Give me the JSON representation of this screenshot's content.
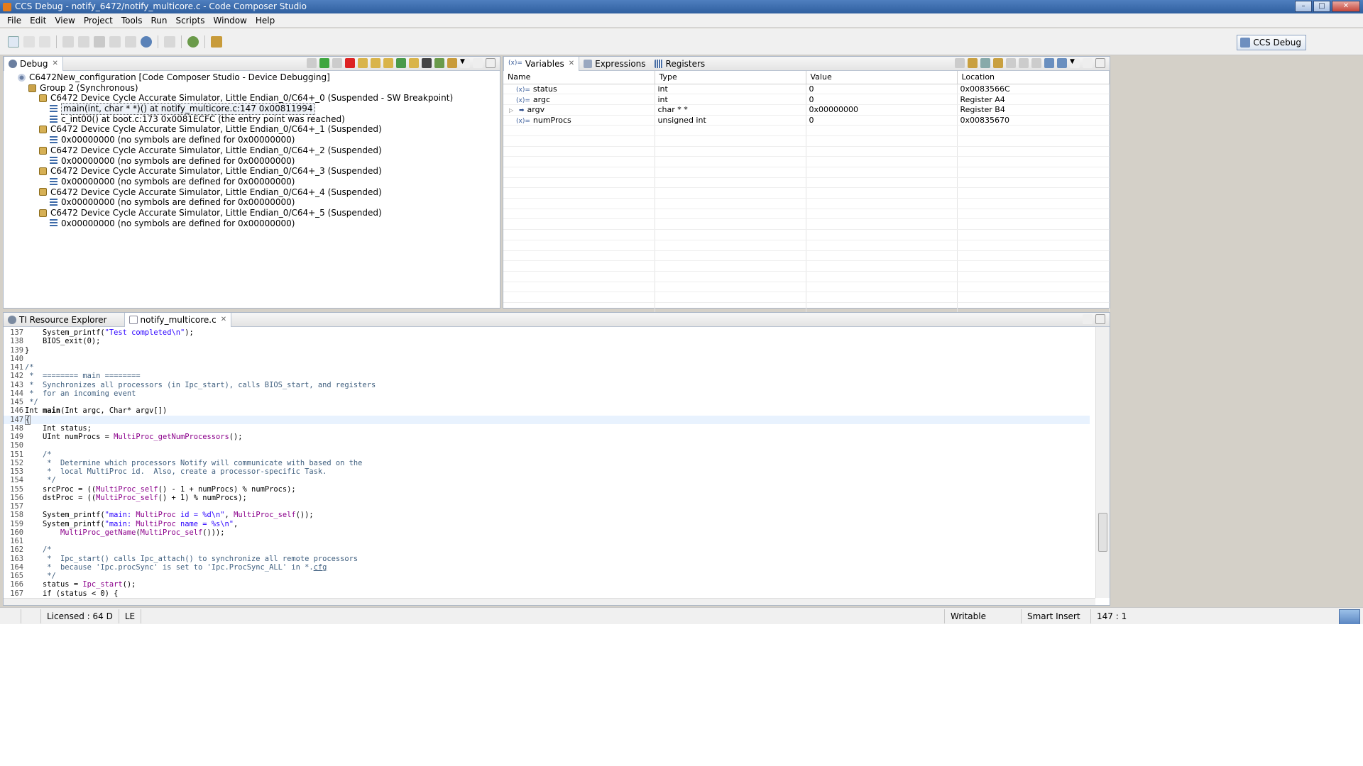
{
  "window": {
    "title": "CCS Debug - notify_6472/notify_multicore.c - Code Composer Studio"
  },
  "menu": [
    "File",
    "Edit",
    "View",
    "Project",
    "Tools",
    "Run",
    "Scripts",
    "Window",
    "Help"
  ],
  "perspective": {
    "label": "CCS Debug"
  },
  "debug_view": {
    "tab_label": "Debug",
    "rows": [
      {
        "indent": 0,
        "icon": "cfg",
        "text": "C6472New_configuration [Code Composer Studio - Device Debugging]"
      },
      {
        "indent": 1,
        "icon": "grp",
        "text": "Group 2 (Synchronous)"
      },
      {
        "indent": 2,
        "icon": "dev",
        "text": "C6472 Device Cycle Accurate Simulator, Little Endian_0/C64+_0 (Suspended - SW Breakpoint)"
      },
      {
        "indent": 3,
        "icon": "frame",
        "text": "main(int, char * *)() at notify_multicore.c:147 0x00811994",
        "selected": true
      },
      {
        "indent": 3,
        "icon": "frame",
        "text": "c_int00() at boot.c:173 0x0081ECFC  (the entry point was reached)"
      },
      {
        "indent": 2,
        "icon": "dev",
        "text": "C6472 Device Cycle Accurate Simulator, Little Endian_0/C64+_1 (Suspended)"
      },
      {
        "indent": 3,
        "icon": "frame",
        "text": "0x00000000  (no symbols are defined for 0x00000000)"
      },
      {
        "indent": 2,
        "icon": "dev",
        "text": "C6472 Device Cycle Accurate Simulator, Little Endian_0/C64+_2 (Suspended)"
      },
      {
        "indent": 3,
        "icon": "frame",
        "text": "0x00000000  (no symbols are defined for 0x00000000)"
      },
      {
        "indent": 2,
        "icon": "dev",
        "text": "C6472 Device Cycle Accurate Simulator, Little Endian_0/C64+_3 (Suspended)"
      },
      {
        "indent": 3,
        "icon": "frame",
        "text": "0x00000000  (no symbols are defined for 0x00000000)"
      },
      {
        "indent": 2,
        "icon": "dev",
        "text": "C6472 Device Cycle Accurate Simulator, Little Endian_0/C64+_4 (Suspended)"
      },
      {
        "indent": 3,
        "icon": "frame",
        "text": "0x00000000  (no symbols are defined for 0x00000000)"
      },
      {
        "indent": 2,
        "icon": "dev",
        "text": "C6472 Device Cycle Accurate Simulator, Little Endian_0/C64+_5 (Suspended)"
      },
      {
        "indent": 3,
        "icon": "frame",
        "text": "0x00000000  (no symbols are defined for 0x00000000)"
      }
    ]
  },
  "variables_view": {
    "tabs": [
      "Variables",
      "Expressions",
      "Registers"
    ],
    "columns": [
      "Name",
      "Type",
      "Value",
      "Location"
    ],
    "rows": [
      {
        "name": "status",
        "type": "int",
        "value": "0",
        "location": "0x0083566C",
        "expandable": false
      },
      {
        "name": "argc",
        "type": "int",
        "value": "0",
        "location": "Register A4",
        "expandable": false
      },
      {
        "name": "argv",
        "type": "char * *",
        "value": "0x00000000",
        "location": "Register B4",
        "expandable": true
      },
      {
        "name": "numProcs",
        "type": "unsigned int",
        "value": "0",
        "location": "0x00835670",
        "expandable": false
      }
    ]
  },
  "editor": {
    "tabs": [
      "TI Resource Explorer",
      "notify_multicore.c"
    ],
    "current_line": 147,
    "lines": [
      {
        "n": "137",
        "html": "    System_printf(<span class=\"str\">\"Test completed\\n\"</span>);"
      },
      {
        "n": "138",
        "html": "    BIOS_exit(0);"
      },
      {
        "n": "139",
        "html": "}"
      },
      {
        "n": "140",
        "html": ""
      },
      {
        "n": "141",
        "html": "<span class=\"com\">/*</span>"
      },
      {
        "n": "142",
        "html": "<span class=\"com\"> *  ======== main ========</span>"
      },
      {
        "n": "143",
        "html": "<span class=\"com\"> *  Synchronizes all processors (in Ipc_start), calls BIOS_start, and registers</span>"
      },
      {
        "n": "144",
        "html": "<span class=\"com\"> *  for an incoming event</span>"
      },
      {
        "n": "145",
        "html": "<span class=\"com\"> */</span>"
      },
      {
        "n": "146",
        "html": "Int <b>main</b>(Int argc, Char* argv[])"
      },
      {
        "n": "147",
        "html": "<span class=\"bracket-box\">{</span>"
      },
      {
        "n": "148",
        "html": "    Int status;"
      },
      {
        "n": "149",
        "html": "    UInt numProcs = <span class=\"fn\">MultiProc_getNumProcessors</span>();"
      },
      {
        "n": "150",
        "html": ""
      },
      {
        "n": "151",
        "html": "<span class=\"com\">    /*</span>"
      },
      {
        "n": "152",
        "html": "<span class=\"com\">     *  Determine which processors Notify will communicate with based on the</span>"
      },
      {
        "n": "153",
        "html": "<span class=\"com\">     *  local MultiProc id.  Also, create a processor-specific Task.</span>"
      },
      {
        "n": "154",
        "html": "<span class=\"com\">     */</span>"
      },
      {
        "n": "155",
        "html": "    srcProc = ((<span class=\"fn\">MultiProc_self</span>() - 1 + numProcs) % numProcs);"
      },
      {
        "n": "156",
        "html": "    dstProc = ((<span class=\"fn\">MultiProc_self</span>() + 1) % numProcs);"
      },
      {
        "n": "157",
        "html": ""
      },
      {
        "n": "158",
        "html": "    System_printf(<span class=\"str\">\"main: </span><span class=\"fn\">MultiProc</span><span class=\"str\"> id = %d\\n\"</span>, <span class=\"fn\">MultiProc_self</span>());"
      },
      {
        "n": "159",
        "html": "    System_printf(<span class=\"str\">\"main: </span><span class=\"fn\">MultiProc</span><span class=\"str\"> name = %s\\n\"</span>,"
      },
      {
        "n": "160",
        "html": "        <span class=\"fn\">MultiProc_getName</span>(<span class=\"fn\">MultiProc_self</span>()));"
      },
      {
        "n": "161",
        "html": ""
      },
      {
        "n": "162",
        "html": "<span class=\"com\">    /*</span>"
      },
      {
        "n": "163",
        "html": "<span class=\"com\">     *  Ipc_start() calls Ipc_attach() to synchronize all remote processors</span>"
      },
      {
        "n": "164",
        "html": "<span class=\"com\">     *  because 'Ipc.procSync' is set to 'Ipc.ProcSync_ALL' in *.<u>cfg</u></span>"
      },
      {
        "n": "165",
        "html": "<span class=\"com\">     */</span>"
      },
      {
        "n": "166",
        "html": "    status = <span class=\"fn\">Ipc_start</span>();"
      },
      {
        "n": "167",
        "html": "    if (status &lt; 0) {"
      }
    ]
  },
  "statusbar": {
    "license": "Licensed : 64 D",
    "endian": "LE",
    "writable": "Writable",
    "insert_mode": "Smart Insert",
    "position": "147 : 1"
  }
}
